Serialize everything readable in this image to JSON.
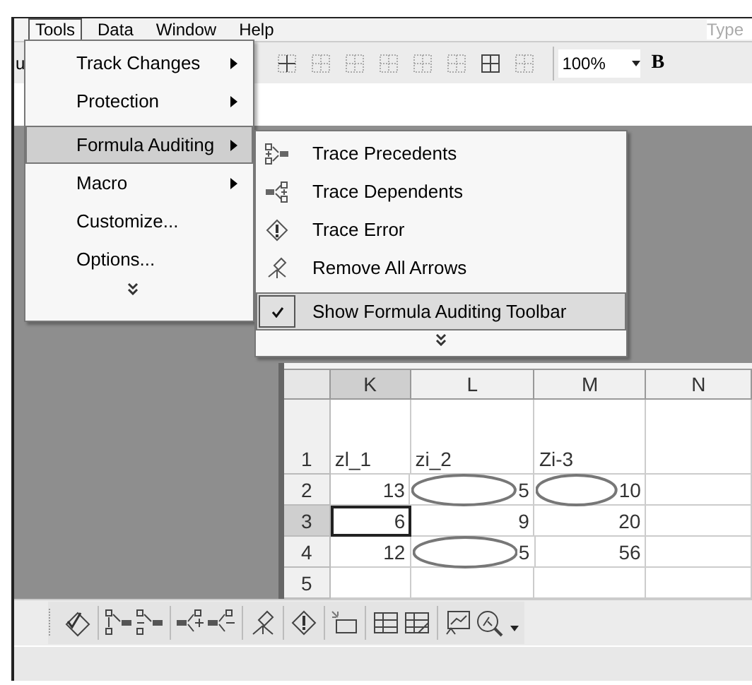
{
  "menu_bar": [
    {
      "label": "Tools",
      "selected": true
    },
    {
      "label": "Data",
      "selected": false
    },
    {
      "label": "Window",
      "selected": false
    },
    {
      "label": "Help",
      "selected": false
    }
  ],
  "ask_box": {
    "placeholder": "Type"
  },
  "toolbar": {
    "cut_label": "u",
    "zoom": "100%",
    "bold": "B"
  },
  "tools_menu": {
    "items": [
      {
        "label": "Track Changes",
        "submenu": true,
        "selected": false
      },
      {
        "label": "Protection",
        "submenu": true,
        "selected": false
      },
      {
        "label": "Formula Auditing",
        "submenu": true,
        "selected": true
      },
      {
        "label": "Macro",
        "submenu": true,
        "selected": false
      },
      {
        "label": "Customize...",
        "submenu": false,
        "selected": false
      },
      {
        "label": "Options...",
        "submenu": false,
        "selected": false
      }
    ]
  },
  "auditing_menu": {
    "items": [
      {
        "label": "Trace Precedents",
        "kind": "precedents",
        "checked": false,
        "selected": false
      },
      {
        "label": "Trace Dependents",
        "kind": "dependents",
        "checked": false,
        "selected": false
      },
      {
        "label": "Trace Error",
        "kind": "error",
        "checked": false,
        "selected": false
      },
      {
        "label": "Remove All Arrows",
        "kind": "remove",
        "checked": false,
        "selected": false
      },
      {
        "label": "Show Formula Auditing Toolbar",
        "kind": "toolbar",
        "checked": true,
        "selected": true
      }
    ]
  },
  "sheet": {
    "columns": [
      {
        "label": "K",
        "selected": true
      },
      {
        "label": "L",
        "selected": false
      },
      {
        "label": "M",
        "selected": false
      },
      {
        "label": "N",
        "selected": false
      }
    ],
    "rows": [
      {
        "label": "1",
        "selected": false,
        "cells": [
          {
            "value": "zl_1",
            "circled": false,
            "selected": false
          },
          {
            "value": "zi_2",
            "circled": false,
            "selected": false
          },
          {
            "value": "Zi-3",
            "circled": false,
            "selected": false
          },
          {
            "circled": false,
            "selected": false
          }
        ]
      },
      {
        "label": "2",
        "selected": false,
        "cells": [
          {
            "value": "13",
            "circled": false,
            "selected": false
          },
          {
            "value": "5",
            "circled": true,
            "selected": false
          },
          {
            "value": "10",
            "circled": true,
            "selected": false
          },
          {
            "circled": false,
            "selected": false
          }
        ]
      },
      {
        "label": "3",
        "selected": true,
        "cells": [
          {
            "value": "6",
            "circled": false,
            "selected": true
          },
          {
            "value": "9",
            "circled": false,
            "selected": false
          },
          {
            "value": "20",
            "circled": false,
            "selected": false
          },
          {
            "circled": false,
            "selected": false
          }
        ]
      },
      {
        "label": "4",
        "selected": false,
        "cells": [
          {
            "value": "12",
            "circled": false,
            "selected": false
          },
          {
            "value": "5",
            "circled": true,
            "selected": false
          },
          {
            "value": "56",
            "circled": false,
            "selected": false
          },
          {
            "circled": false,
            "selected": false
          }
        ]
      },
      {
        "label": "5",
        "selected": false,
        "cells": [
          {
            "circled": false,
            "selected": false
          },
          {
            "circled": false,
            "selected": false
          },
          {
            "circled": false,
            "selected": false
          },
          {
            "circled": false,
            "selected": false
          }
        ]
      }
    ]
  }
}
